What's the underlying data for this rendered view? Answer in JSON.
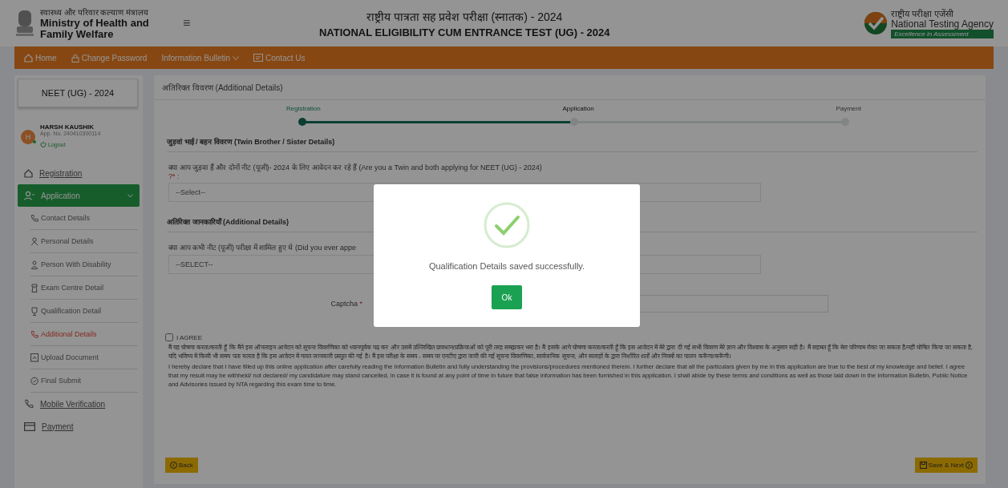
{
  "header": {
    "ministry_hindi": "स्वास्थ्य और परिवार कल्याण मंत्रालय",
    "ministry_english": "Ministry of Health and Family Welfare",
    "menu_glyph": "≡",
    "title_hindi": "राष्ट्रीय पात्रता सह प्रवेश परीक्षा (स्नातक) - 2024",
    "title_english": "NATIONAL ELIGIBILITY CUM ENTRANCE TEST (UG) - 2024",
    "agency_hindi": "राष्ट्रीय परीक्षा एजेंसी",
    "agency_english": "National Testing Agency",
    "agency_tagline": "Excellence in Assessment"
  },
  "nav": [
    {
      "label": "Home",
      "kind": "home",
      "dropdown": false
    },
    {
      "label": "Change Password",
      "kind": "lock",
      "dropdown": false
    },
    {
      "label": "Information Bulletin",
      "kind": "none",
      "dropdown": true
    },
    {
      "label": "Contact Us",
      "kind": "contact",
      "dropdown": false
    }
  ],
  "sidebar": {
    "exam": "NEET (UG) - 2024",
    "user": {
      "name": "HARSH KAUSHIK",
      "app_no": "App. No. 240410300114",
      "status": "Logout",
      "initial": "H"
    },
    "menu": [
      {
        "label": "Registration",
        "kind": "home",
        "selected": false
      },
      {
        "label": "Application",
        "kind": "user",
        "selected": true,
        "expanded": true,
        "children": [
          {
            "label": "Contact Details",
            "selected": false
          },
          {
            "label": "Personal Details",
            "selected": false
          },
          {
            "label": "Person With Disability",
            "selected": false
          },
          {
            "label": "Exam Centre Detail",
            "selected": false
          },
          {
            "label": "Qualification Detail",
            "selected": false
          },
          {
            "label": "Additional Details",
            "selected": true
          },
          {
            "label": "Upload Document",
            "selected": false
          },
          {
            "label": "Final Submit",
            "selected": false
          }
        ]
      },
      {
        "label": "Mobile Verification",
        "kind": "phone",
        "selected": false
      },
      {
        "label": "Payment",
        "kind": "card",
        "selected": false
      }
    ]
  },
  "main": {
    "title": "अतिरिक्त विवरण (Additional Details)",
    "stepper": {
      "level": 0.5,
      "steps": [
        {
          "label": "Registration",
          "completed": true,
          "selected": false
        },
        {
          "label": "Application",
          "completed": false,
          "selected": true
        },
        {
          "label": "Payment",
          "completed": false,
          "selected": false
        }
      ]
    },
    "sections": [
      {
        "heading": "जुड़वां भाई / बहन विवरण (Twin Brother / Sister Details)",
        "question": "क्या आप जुड़वा हैं और दोनों नीट (यूजी)- 2024 के लिए आवेदन कर रहे हैं (Are you a Twin and both applying for NEET (UG) - 2024)",
        "question_suffix": "?* :",
        "select": "--Select--"
      },
      {
        "heading": "अतिरिक्त जानकारियाँ (Additional Details)",
        "question": "क्या आप कभी नीट (यूजी) परीक्षा में शामिल हुए थे (Did you ever appe",
        "select": "--SELECT--"
      }
    ],
    "captcha": {
      "label": "Captcha",
      "required": "*"
    },
    "agree": {
      "label": "I AGREE",
      "checked": false,
      "hindi": "मैं यह घोषणा करता/करती हूँ कि मैंने इस ऑनलाइन आवेदन को सूचना विवरणिका को ध्यानपूर्वक पढ़ कर और उसमें उल्लिखित प्रावधान/प्रक्रियाओं को पूरी तरह समझकर भरा है। मैं इसके आगे घोषणा करता/करती हूँ कि इस आवेदन में मेरे द्वारा दी गई सभी विवरण मेरे ज्ञान और विश्वास के अनुसार सही है। मैं सहमत हूँ कि मेरा परिणाम रोका जा सकता है/नहीं घोषित किया जा सकता है, यदि भविष्य में किसी भी समय पता चलता है कि इस आवेदन में गलत जानकारी प्रस्तुत की गई है। मैं इस परीक्षा के समय - समय पर एनटीए द्वारा जारी की गई सूचना विवरणिका, सार्वजनिक सूचना, और सलाहों के द्वारा निर्धारित शर्तों और नियमों का पालन करूँगा/करूँगी।",
      "english": "I hereby declare that I have filled up this online application after carefully reading the Information Bulletin and fully understanding the provisions/procedures mentioned therein. I further declare that all the particulars given by me in this application are true to the best of my knowledge and belief. I agree that my result may be withheld/ not declared/ my candidature may stand cancelled, in case it is found at any point of time in future that false information has been furnished in this application. I shall abide by these terms and conditions as well as those laid down in the Information Bulletin, Public Notice and Advisories issued by NTA regarding this exam time to time."
    },
    "buttons": [
      {
        "label": "Back",
        "kind": "back"
      },
      {
        "label": "Save & Next",
        "kind": "next"
      }
    ]
  },
  "modal": {
    "message": "Qualification Details saved successfully.",
    "button": "Ok"
  }
}
